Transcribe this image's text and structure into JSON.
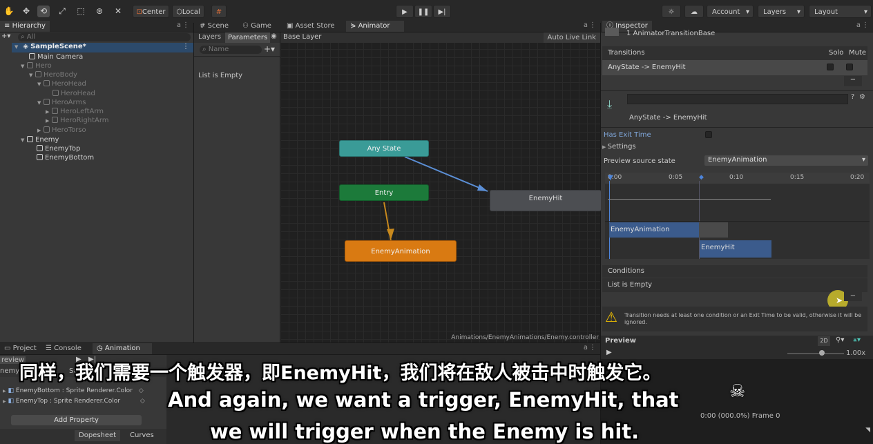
{
  "toolbar": {
    "pivot": "Center",
    "space": "Local",
    "account": "Account",
    "layers": "Layers",
    "layout": "Layout"
  },
  "hierarchy": {
    "tab": "Hierarchy",
    "search_placeholder": "All",
    "scene": "SampleScene*",
    "items": [
      {
        "label": "Main Camera"
      },
      {
        "label": "Hero"
      },
      {
        "label": "HeroBody"
      },
      {
        "label": "HeroHead"
      },
      {
        "label": "HeroHead"
      },
      {
        "label": "HeroArms"
      },
      {
        "label": "HeroLeftArm"
      },
      {
        "label": "HeroRightArm"
      },
      {
        "label": "HeroTorso"
      },
      {
        "label": "Enemy"
      },
      {
        "label": "EnemyTop"
      },
      {
        "label": "EnemyBottom"
      }
    ]
  },
  "center_tabs": {
    "scene": "Scene",
    "game": "Game",
    "asset_store": "Asset Store",
    "animator": "Animator"
  },
  "animator": {
    "layers_tab": "Layers",
    "parameters_tab": "Parameters",
    "breadcrumb": "Base Layer",
    "auto_live_link": "Auto Live Link",
    "param_search_placeholder": "Name",
    "list_empty": "List is Empty",
    "nodes": {
      "any_state": "Any State",
      "entry": "Entry",
      "enemy_animation": "EnemyAnimation",
      "enemy_hit": "EnemyHit"
    },
    "path": "Animations/EnemyAnimations/Enemy.controller"
  },
  "inspector": {
    "tab": "Inspector",
    "object_title": "1 AnimatorTransitionBase",
    "transitions_label": "Transitions",
    "solo": "Solo",
    "mute": "Mute",
    "transition_row": "AnyState -> EnemyHit",
    "transition_name": "AnyState -> EnemyHit",
    "has_exit_time": "Has Exit Time",
    "settings": "Settings",
    "preview_source_label": "Preview source state",
    "preview_source_value": "EnemyAnimation",
    "timeline_ticks": [
      "0:00",
      "0:05",
      "0:10",
      "0:15",
      "0:20"
    ],
    "bar_source": "EnemyAnimation",
    "bar_target": "EnemyHit",
    "conditions_label": "Conditions",
    "conditions_empty": "List is Empty",
    "warning": "Transition needs at least one condition or an Exit Time to be valid, otherwise it will be ignored.",
    "preview_label": "Preview",
    "preview_2d": "2D",
    "speed": "1.00x",
    "frame_info": "0:00 (000.0%) Frame 0"
  },
  "bottom": {
    "project_tab": "Project",
    "console_tab": "Console",
    "animation_tab": "Animation",
    "preview_label": "review",
    "clip_label": "nemyl",
    "clip_sample": "Sample",
    "properties": [
      "EnemyBottom : Sprite Renderer.Color",
      "EnemyTop : Sprite Renderer.Color"
    ],
    "add_property": "Add Property",
    "dopesheet": "Dopesheet",
    "curves": "Curves"
  },
  "subtitles": {
    "chinese": "同样，我们需要一个触发器，即EnemyHit，我们将在敌人被击中时触发它。",
    "english_line1": "And again, we want a trigger, EnemyHit, that",
    "english_line2": "we will trigger when the Enemy is hit."
  }
}
